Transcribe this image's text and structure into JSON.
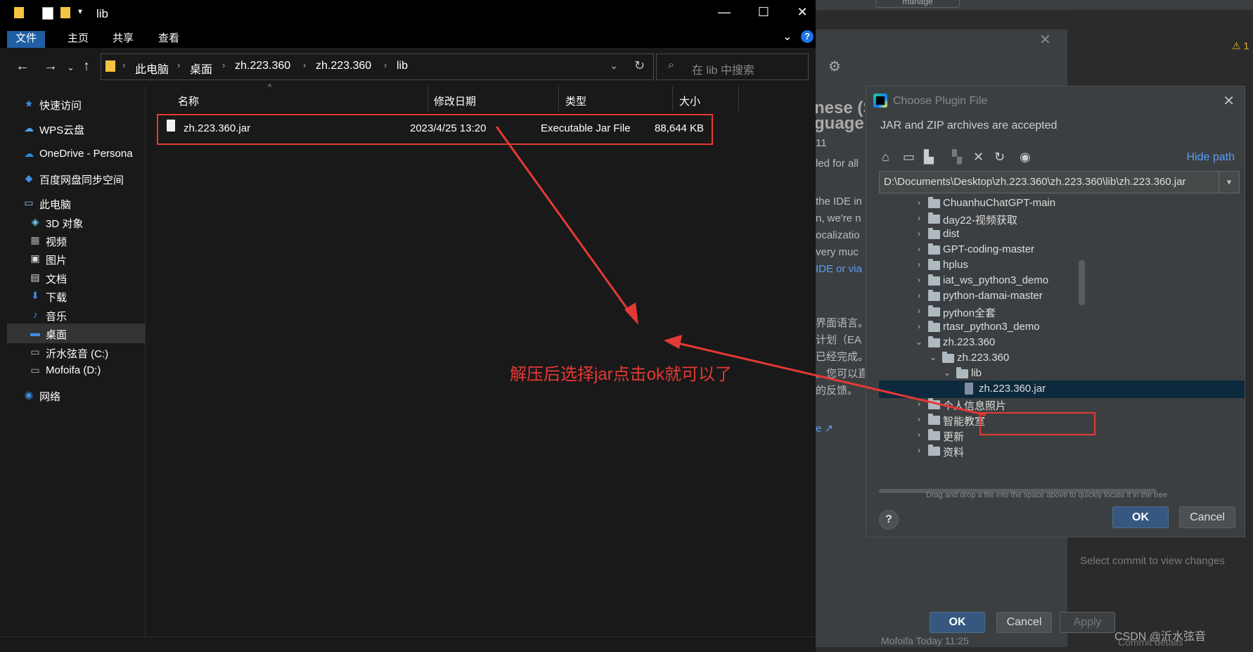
{
  "ide": {
    "manage_label": "manage",
    "warning_label": "⚠ 1",
    "bg_text": [
      "nese (S",
      "guage",
      "11",
      "led for all",
      "the IDE in",
      "n, we're n",
      "ocalizatio",
      "very muc",
      "IDE or via",
      "界面语言。",
      "计划（EA",
      "已经完成。",
      "。您可以直",
      "的反馈。",
      "e ↗"
    ],
    "select_commit": "Select commit to view changes",
    "ok_label": "OK",
    "cancel_label": "Cancel",
    "apply_label": "Apply",
    "watermark": "CSDN @沂水弦音",
    "commit_details": "Commit details",
    "bottom_label": "Mofoifa    Today 11:25"
  },
  "explorer": {
    "title": "lib",
    "ribbon_tabs": [
      "文件",
      "主页",
      "共享",
      "查看"
    ],
    "breadcrumbs": [
      "此电脑",
      "桌面",
      "zh.223.360",
      "zh.223.360",
      "lib"
    ],
    "search_placeholder": "在 lib 中搜索",
    "nav_items": [
      {
        "label": "快速访问",
        "icon": "star-icon"
      },
      {
        "label": "WPS云盘",
        "icon": "cloud-icon"
      },
      {
        "label": "OneDrive - Persona",
        "icon": "onedrive-icon"
      },
      {
        "label": "百度网盘同步空间",
        "icon": "baidu-icon"
      },
      {
        "label": "此电脑",
        "icon": "computer-icon"
      },
      {
        "label": "3D 对象",
        "icon": "cube-icon"
      },
      {
        "label": "视频",
        "icon": "video-icon"
      },
      {
        "label": "图片",
        "icon": "picture-icon"
      },
      {
        "label": "文档",
        "icon": "document-icon"
      },
      {
        "label": "下载",
        "icon": "download-icon"
      },
      {
        "label": "音乐",
        "icon": "music-icon"
      },
      {
        "label": "桌面",
        "icon": "desktop-icon"
      },
      {
        "label": "沂水弦音 (C:)",
        "icon": "drive-icon"
      },
      {
        "label": "Mofoifa (D:)",
        "icon": "drive-icon"
      },
      {
        "label": "网络",
        "icon": "network-icon"
      }
    ],
    "columns": [
      "名称",
      "修改日期",
      "类型",
      "大小"
    ],
    "file": {
      "name": "zh.223.360.jar",
      "modified": "2023/4/25 13:20",
      "type": "Executable Jar File",
      "size": "88,644 KB"
    }
  },
  "annotation": {
    "text": "解压后选择jar点击ok就可以了",
    "color": "#e53935"
  },
  "dialog": {
    "title": "Choose Plugin File",
    "subtitle": "JAR and ZIP archives are accepted",
    "hide_path": "Hide path",
    "path": "D:\\Documents\\Desktop\\zh.223.360\\zh.223.360\\lib\\zh.223.360.jar",
    "tree": [
      {
        "name": "ChuanhuChatGPT-main",
        "level": 0,
        "expanded": false,
        "kind": "folder"
      },
      {
        "name": "day22-视频获取",
        "level": 0,
        "expanded": false,
        "kind": "folder"
      },
      {
        "name": "dist",
        "level": 0,
        "expanded": false,
        "kind": "folder"
      },
      {
        "name": "GPT-coding-master",
        "level": 0,
        "expanded": false,
        "kind": "folder"
      },
      {
        "name": "hplus",
        "level": 0,
        "expanded": false,
        "kind": "folder"
      },
      {
        "name": "iat_ws_python3_demo",
        "level": 0,
        "expanded": false,
        "kind": "folder"
      },
      {
        "name": "python-damai-master",
        "level": 0,
        "expanded": false,
        "kind": "folder"
      },
      {
        "name": "python全套",
        "level": 0,
        "expanded": false,
        "kind": "folder"
      },
      {
        "name": "rtasr_python3_demo",
        "level": 0,
        "expanded": false,
        "kind": "folder"
      },
      {
        "name": "zh.223.360",
        "level": 0,
        "expanded": true,
        "kind": "folder"
      },
      {
        "name": "zh.223.360",
        "level": 1,
        "expanded": true,
        "kind": "folder"
      },
      {
        "name": "lib",
        "level": 2,
        "expanded": true,
        "kind": "folder"
      },
      {
        "name": "zh.223.360.jar",
        "level": 3,
        "expanded": false,
        "kind": "jar",
        "selected": true
      },
      {
        "name": "个人信息照片",
        "level": 0,
        "expanded": false,
        "kind": "folder"
      },
      {
        "name": "智能教室",
        "level": 0,
        "expanded": false,
        "kind": "folder"
      },
      {
        "name": "更新",
        "level": 0,
        "expanded": false,
        "kind": "folder"
      },
      {
        "name": "资料",
        "level": 0,
        "expanded": false,
        "kind": "folder"
      }
    ],
    "hint": "Drag and drop a file into the space above to quickly locate it in the tree",
    "ok_label": "OK",
    "cancel_label": "Cancel"
  }
}
